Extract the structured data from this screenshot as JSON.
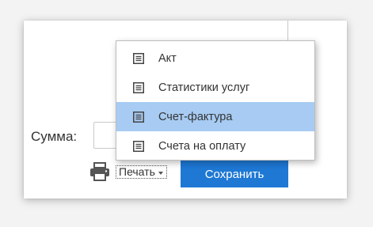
{
  "form": {
    "sum_label": "Сумма:",
    "sum_value": ""
  },
  "print": {
    "icon": "printer-icon",
    "label": "Печать"
  },
  "save": {
    "label": "Сохранить",
    "color": "#1e78d4"
  },
  "menu": {
    "items": [
      {
        "label": "Акт",
        "icon": "document-icon"
      },
      {
        "label": "Статистики услуг",
        "icon": "document-icon"
      },
      {
        "label": "Счет-фактура",
        "icon": "document-icon",
        "selected": true
      },
      {
        "label": "Счета на оплату",
        "icon": "document-icon"
      }
    ],
    "selected_color": "#a7cbf2"
  }
}
